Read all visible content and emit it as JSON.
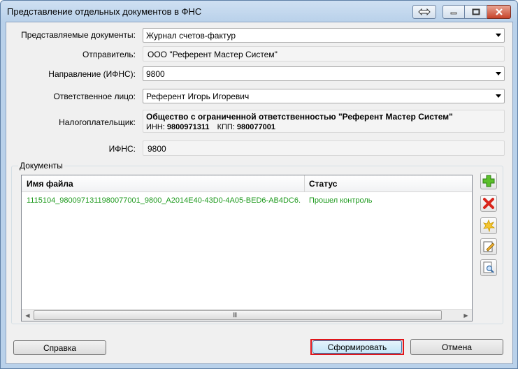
{
  "window": {
    "title": "Представление отдельных документов в ФНС"
  },
  "form": {
    "documents_label": "Представляемые документы:",
    "documents_value": "Журнал счетов-фактур",
    "sender_label": "Отправитель:",
    "sender_value": "ООО \"Референт Мастер Систем\"",
    "direction_label": "Направление (ИФНС):",
    "direction_value": "9800",
    "responsible_label": "Ответственное лицо:",
    "responsible_value": "Референт Игорь Игоревич",
    "taxpayer_label": "Налогоплательщик:",
    "taxpayer_name": "Общество с ограниченной ответственностью \"Референт Мастер Систем\"",
    "inn_label": "ИНН:",
    "inn_value": "9800971311",
    "kpp_label": "КПП:",
    "kpp_value": "980077001",
    "ifns_label": "ИФНС:",
    "ifns_value": "9800"
  },
  "documents": {
    "group_label": "Документы",
    "columns": [
      "Имя файла",
      "Статус"
    ],
    "rows": [
      {
        "filename": "1115104_9800971311980077001_9800_A2014E40-43D0-4A05-BED6-AB4DC6...",
        "status": "Прошел контроль"
      }
    ],
    "scroll_grip": "III",
    "status_color": "#1e9a1e"
  },
  "side_buttons": [
    "add-icon",
    "delete-icon",
    "clear-icon",
    "edit-icon",
    "preview-icon"
  ],
  "footer": {
    "help_label": "Справка",
    "generate_label": "Сформировать",
    "cancel_label": "Отмена"
  }
}
